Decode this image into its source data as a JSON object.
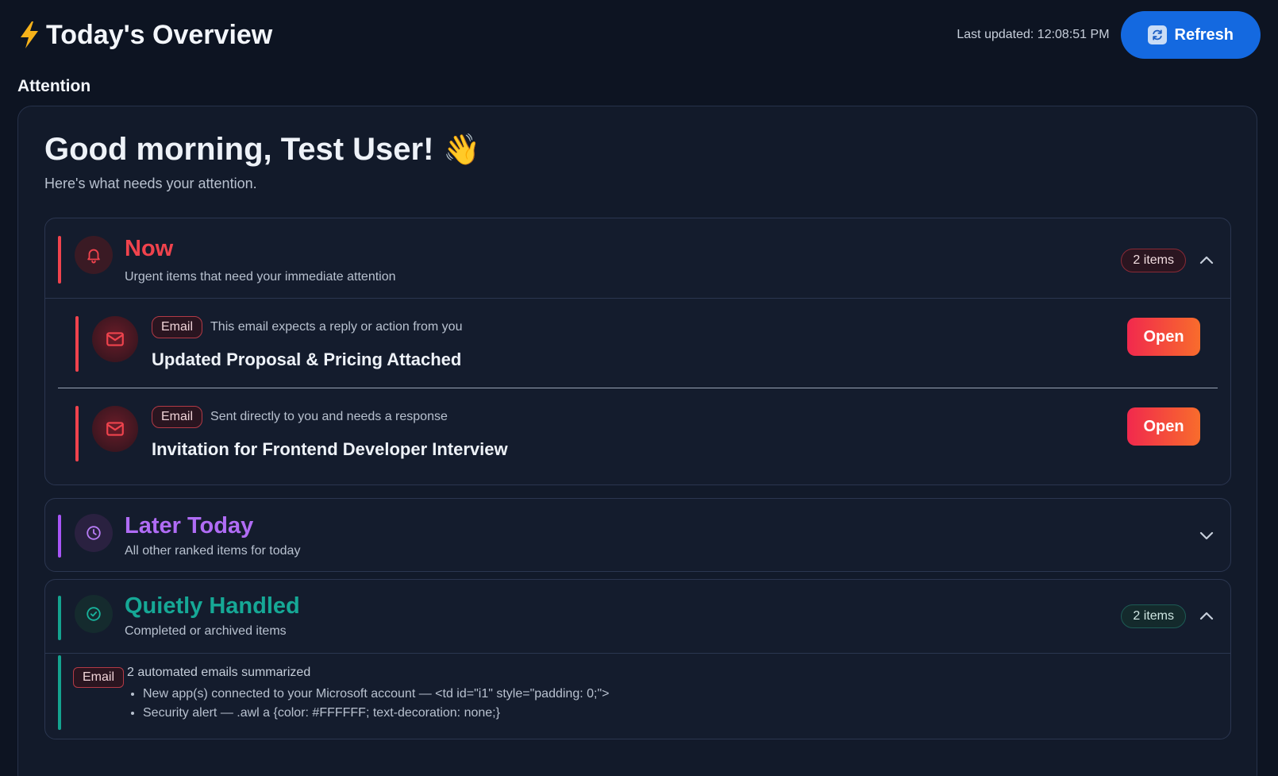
{
  "header": {
    "title": "Today's Overview",
    "last_updated": "Last updated: 12:08:51 PM",
    "refresh_label": "Refresh"
  },
  "section_label": "Attention",
  "greeting": {
    "title": "Good morning, Test User!",
    "emoji": "👋",
    "subtitle": "Here's what needs your attention."
  },
  "groups": [
    {
      "title": "Now",
      "subtitle": "Urgent items that need your immediate attention",
      "count": "2 items",
      "color": "#f0434d",
      "expanded": true,
      "icon": "bell-icon",
      "items": [
        {
          "tag": "Email",
          "reason": "This email expects a reply or action from you",
          "title": "Updated Proposal & Pricing Attached",
          "action": "Open",
          "icon": "mail-icon"
        },
        {
          "tag": "Email",
          "reason": "Sent directly to you and needs a response",
          "title": "Invitation for Frontend Developer Interview",
          "action": "Open",
          "icon": "mail-icon"
        }
      ]
    },
    {
      "title": "Later Today",
      "subtitle": "All other ranked items for today",
      "color": "#a855f7",
      "expanded": false,
      "icon": "clock-icon"
    },
    {
      "title": "Quietly Handled",
      "subtitle": "Completed or archived items",
      "count": "2 items",
      "color": "#14a38f",
      "expanded": true,
      "icon": "check-circle-icon",
      "summary": {
        "tag": "Email",
        "heading": "2 automated emails summarized",
        "lines": [
          "New app(s) connected to your Microsoft account — <td id=\"i1\" style=\"padding: 0;\">",
          "Security alert — .awl a {color: #FFFFFF; text-decoration: none;}"
        ]
      }
    }
  ]
}
